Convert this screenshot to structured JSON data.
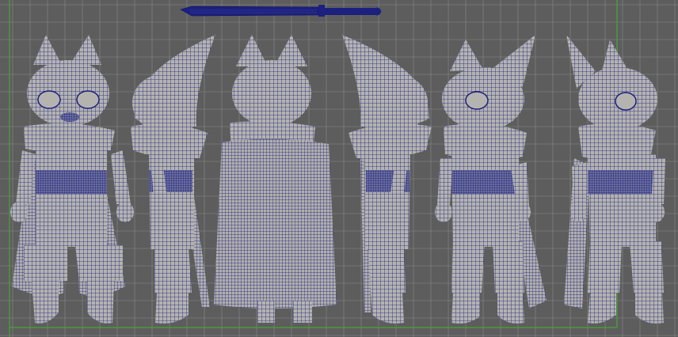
{
  "app": {
    "viewport_name": "orthographic-turnaround-viewport",
    "views": [
      "front",
      "side-right",
      "back",
      "side-left",
      "three-quarter-front",
      "three-quarter-back"
    ]
  },
  "colors": {
    "background": "#5d5d5d",
    "grid": "#8a8a8a",
    "frame": "#4c9a3c",
    "mesh_fill": "#b4b3b0",
    "mesh_line": "#1b1e80",
    "prop": "#1c207e"
  },
  "icons": {
    "prop": "sword-mesh-icon"
  }
}
